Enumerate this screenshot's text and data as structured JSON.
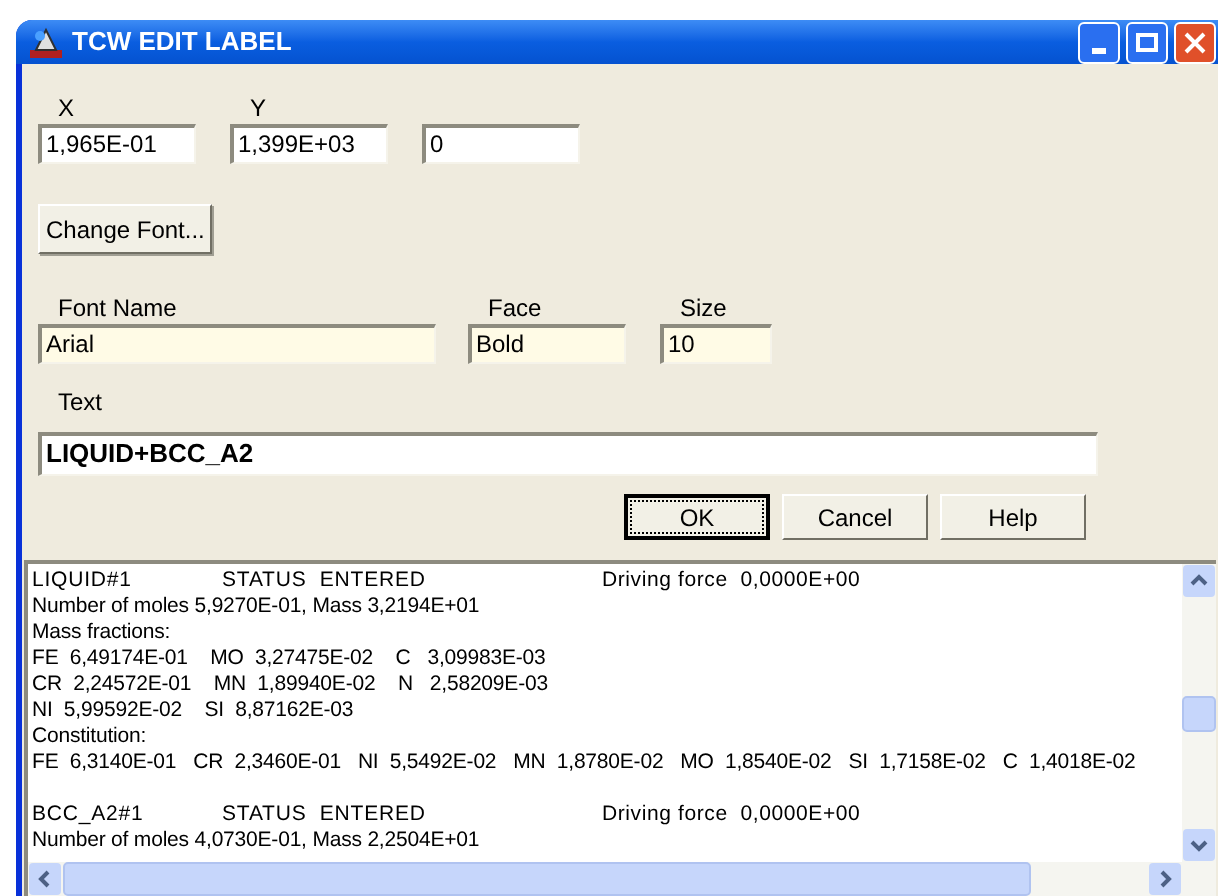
{
  "window": {
    "title": "TCW EDIT LABEL"
  },
  "position": [
    {
      "label": "X",
      "value": "1,965E-01"
    },
    {
      "label": "Y",
      "value": "1,399E+03"
    },
    {
      "value": "0"
    }
  ],
  "change_font_button": "Change Font...",
  "font": [
    {
      "label": "Font Name",
      "value": "Arial"
    },
    {
      "label": "Face",
      "value": "Bold"
    },
    {
      "label": "Size",
      "value": "10"
    }
  ],
  "text": {
    "label": "Text",
    "value": "LIQUID+BCC_A2"
  },
  "buttons": [
    {
      "label": "OK",
      "default": true
    },
    {
      "label": "Cancel",
      "default": false
    },
    {
      "label": "Help",
      "default": false
    }
  ],
  "output": [
    {
      "kind": "header",
      "phase": "LIQUID#1",
      "status": "STATUS  ENTERED",
      "driving": "Driving force  0,0000E+00"
    },
    {
      "kind": "text",
      "text": "Number of moles 5,9270E-01, Mass 3,2194E+01"
    },
    {
      "kind": "text",
      "text": "Mass fractions:"
    },
    {
      "kind": "text",
      "text": "FE  6,49174E-01    MO  3,27475E-02    C   3,09983E-03"
    },
    {
      "kind": "text",
      "text": "CR  2,24572E-01    MN  1,89940E-02    N   2,58209E-03"
    },
    {
      "kind": "text",
      "text": "NI  5,99592E-02    SI  8,87162E-03"
    },
    {
      "kind": "text",
      "text": "Constitution:"
    },
    {
      "kind": "text",
      "text": "FE  6,3140E-01   CR  2,3460E-01   NI  5,5492E-02   MN  1,8780E-02   MO  1,8540E-02   SI  1,7158E-02   C  1,4018E-02"
    },
    {
      "kind": "blank"
    },
    {
      "kind": "header",
      "phase": "BCC_A2#1",
      "status": "STATUS  ENTERED",
      "driving": "Driving force  0,0000E+00"
    },
    {
      "kind": "text",
      "text": "Number of moles 4,0730E-01, Mass 2,2504E+01"
    }
  ]
}
